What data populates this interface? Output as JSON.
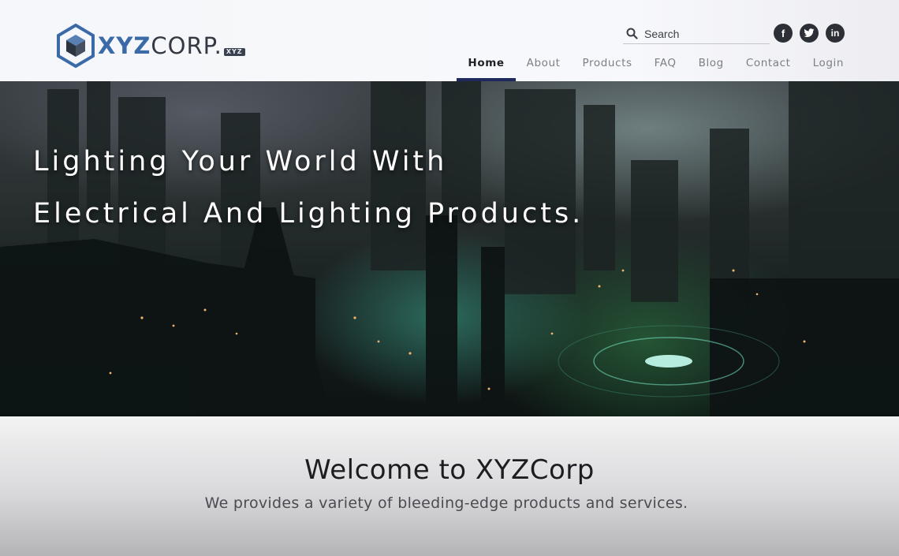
{
  "brand": {
    "logo_main": "XYZ",
    "logo_rest": "CORP.",
    "logo_tag": "XYZ",
    "accent": "#3a6aa8"
  },
  "search": {
    "placeholder": "Search",
    "icon": "search-icon"
  },
  "social": [
    {
      "label": "f",
      "icon": "facebook-icon"
    },
    {
      "label": "t",
      "icon": "twitter-icon"
    },
    {
      "label": "in",
      "icon": "linkedin-icon"
    }
  ],
  "nav": {
    "items": [
      "Home",
      "About",
      "Products",
      "FAQ",
      "Blog",
      "Contact",
      "Login"
    ],
    "active": "Home",
    "active_underline_color": "#1e2a5c"
  },
  "hero": {
    "line1": "Lighting Your World With",
    "line2": "Electrical And Lighting Products."
  },
  "welcome": {
    "title": "Welcome to XYZCorp",
    "subtitle": "We provides a variety of bleeding-edge products and services."
  }
}
